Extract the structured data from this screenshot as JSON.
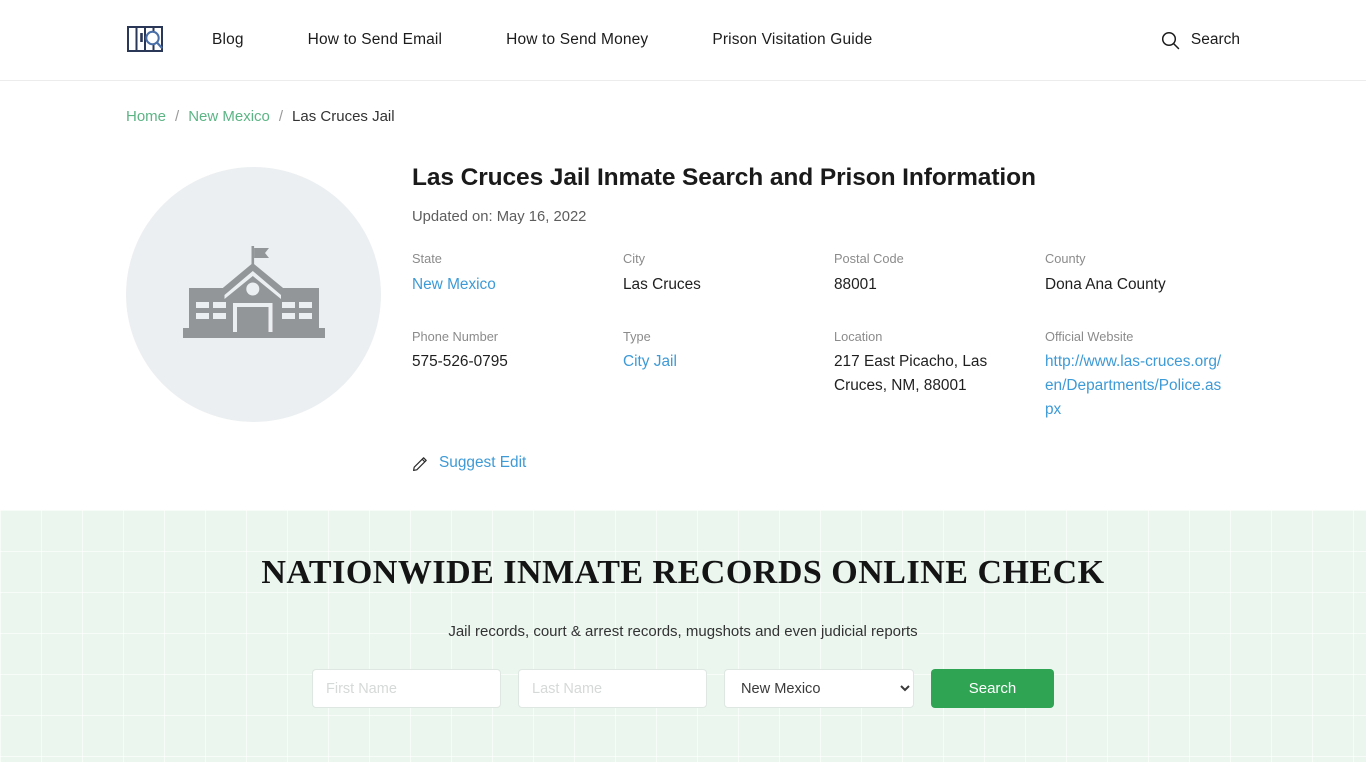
{
  "header": {
    "logo_icon": "jail-bars-search-icon",
    "nav": [
      {
        "label": "Blog"
      },
      {
        "label": "How to Send Email"
      },
      {
        "label": "How to Send Money"
      },
      {
        "label": "Prison Visitation Guide"
      }
    ],
    "search": {
      "label": "Search",
      "icon": "search-icon"
    }
  },
  "breadcrumb": {
    "items": [
      {
        "label": "Home",
        "link": true
      },
      {
        "label": "New Mexico",
        "link": true
      },
      {
        "label": "Las Cruces Jail",
        "link": false
      }
    ],
    "separator": "/"
  },
  "facility": {
    "image_icon": "institution-building-icon",
    "title": "Las Cruces Jail Inmate Search and Prison Information",
    "updated": "Updated on: May 16, 2022",
    "fields": [
      {
        "label": "State",
        "value": "New Mexico",
        "is_link": true
      },
      {
        "label": "City",
        "value": "Las Cruces",
        "is_link": false
      },
      {
        "label": "Postal Code",
        "value": "88001",
        "is_link": false
      },
      {
        "label": "County",
        "value": "Dona Ana County",
        "is_link": false
      },
      {
        "label": "Phone Number",
        "value": "575-526-0795",
        "is_link": false
      },
      {
        "label": "Type",
        "value": "City Jail",
        "is_link": true
      },
      {
        "label": "Location",
        "value": "217 East Picacho, Las Cruces, NM, 88001",
        "is_link": false
      },
      {
        "label": "Official Website",
        "value": "http://www.las-cruces.org/en/Departments/Police.aspx",
        "is_link": true
      }
    ],
    "suggest_edit": {
      "label": "Suggest Edit",
      "icon": "pencil-icon"
    }
  },
  "search_section": {
    "heading": "NATIONWIDE INMATE RECORDS ONLINE CHECK",
    "subheading": "Jail records, court & arrest records, mugshots and even judicial reports",
    "first_name_placeholder": "First Name",
    "first_name_value": "",
    "last_name_placeholder": "Last Name",
    "last_name_value": "",
    "state_selected": "New Mexico",
    "state_options": [
      "New Mexico"
    ],
    "button_label": "Search"
  },
  "colors": {
    "accent_green": "#2fa453",
    "link_blue": "#3d9ad6",
    "breadcrumb_green": "#5cb485",
    "section_bg": "#eaf6ee"
  }
}
